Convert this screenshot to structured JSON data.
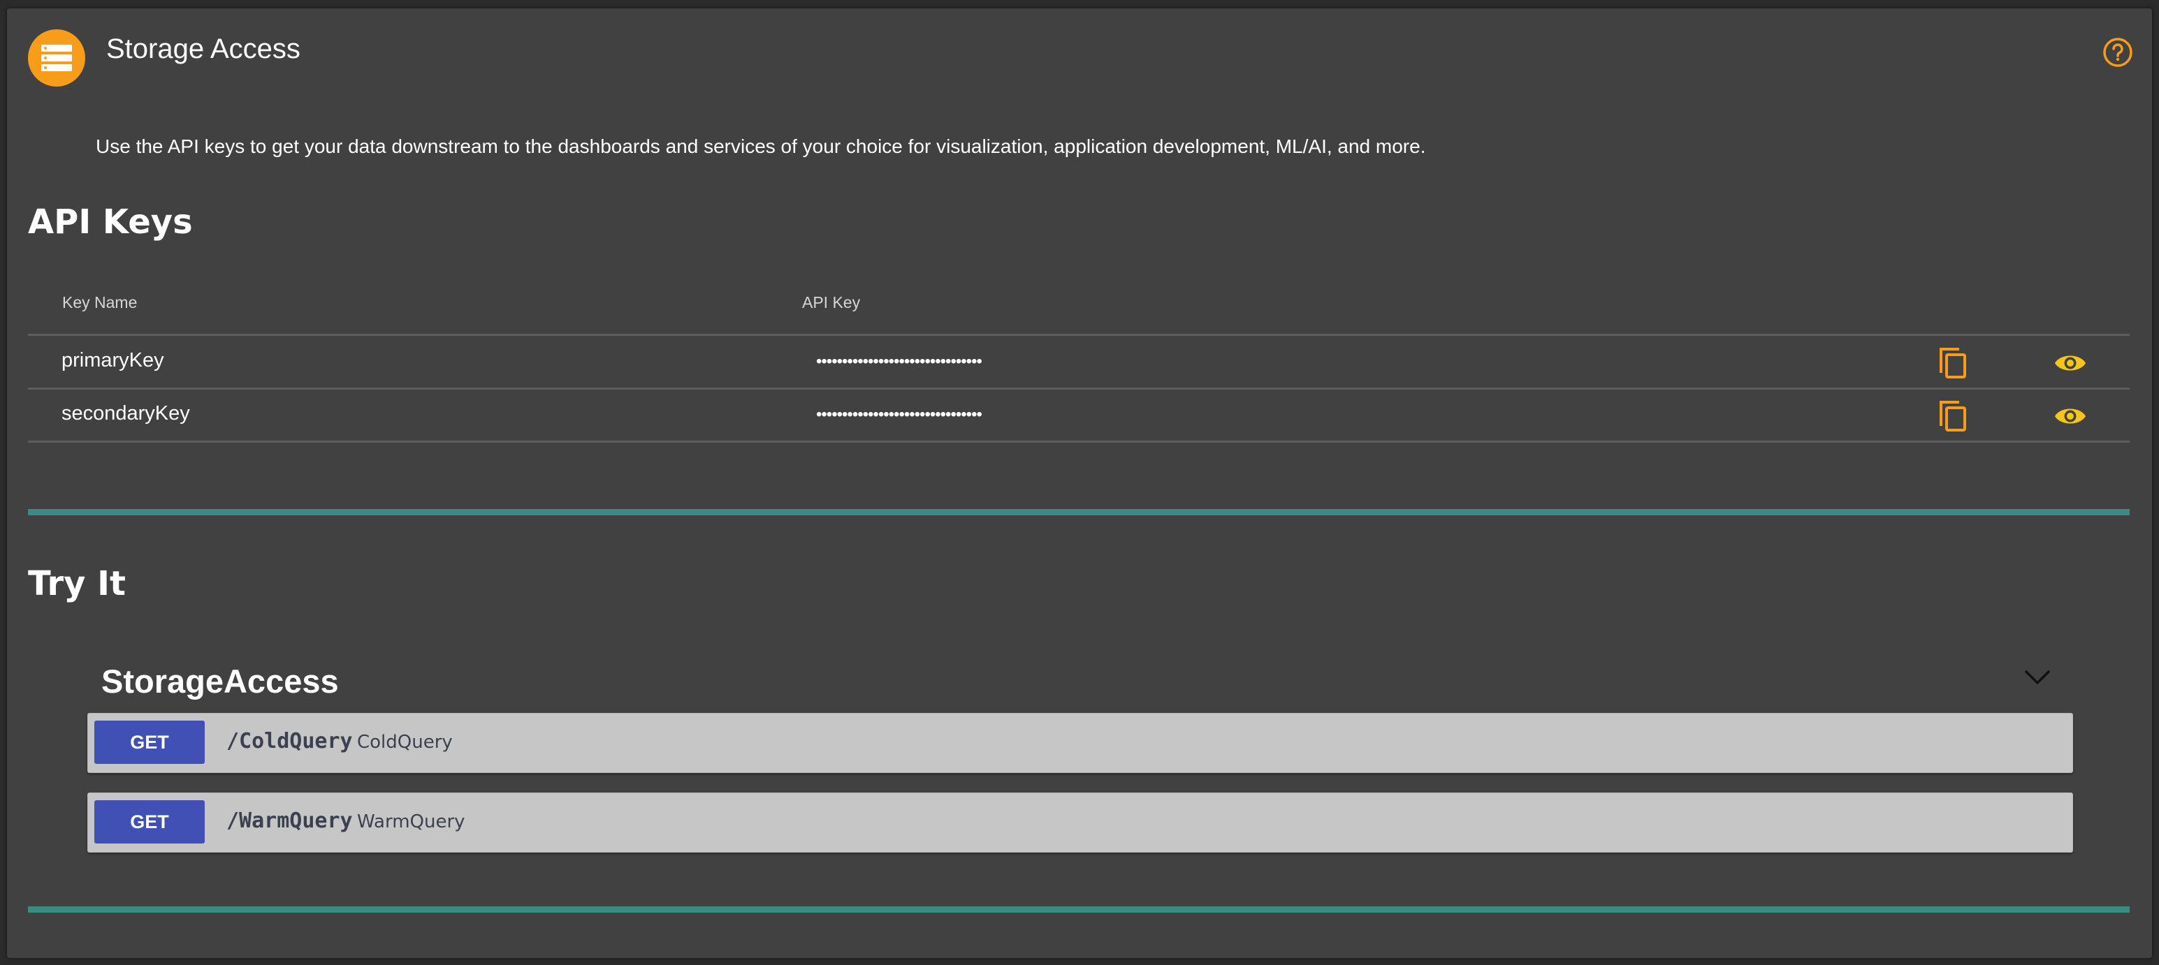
{
  "header": {
    "title": "Storage Access",
    "icon": "storage-icon",
    "help_icon": "help-circle-icon"
  },
  "intro": "Use the API keys to get your data downstream to the dashboards and services of your choice for visualization, application development, ML/AI, and more.",
  "api_keys": {
    "title": "API Keys",
    "columns": [
      "Key Name",
      "API Key"
    ],
    "rows": [
      {
        "name": "primaryKey",
        "value": "••••••••••••••••••••••••••••••••",
        "copy_icon": "copy-icon",
        "view_icon": "eye-icon"
      },
      {
        "name": "secondaryKey",
        "value": "••••••••••••••••••••••••••••••••",
        "copy_icon": "copy-icon",
        "view_icon": "eye-icon"
      }
    ]
  },
  "try_it": {
    "title": "Try It",
    "group": "StorageAccess",
    "operations": [
      {
        "method": "GET",
        "path": "/ColdQuery",
        "summary": "ColdQuery"
      },
      {
        "method": "GET",
        "path": "/WarmQuery",
        "summary": "WarmQuery"
      }
    ]
  },
  "colors": {
    "accent_orange": "#f89d1a",
    "icon_yellow": "#f5c518",
    "teal_divider": "#3e8b85",
    "get_method": "#4150b4",
    "panel_bg": "#414141"
  }
}
